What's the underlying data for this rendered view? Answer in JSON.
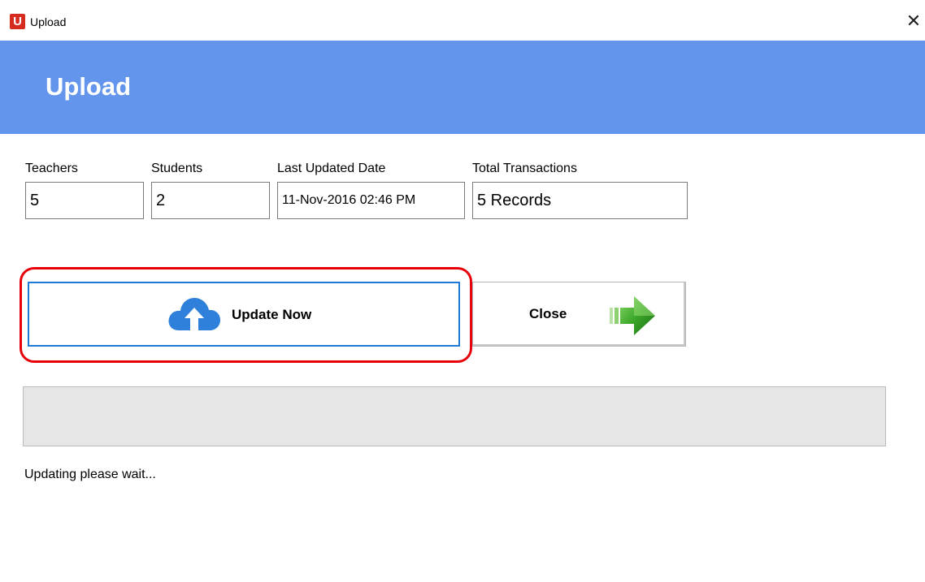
{
  "window": {
    "app_icon_letter": "U",
    "title": "Upload",
    "close_glyph": "✕"
  },
  "header": {
    "title": "Upload",
    "background_color": "#6495ed"
  },
  "fields": {
    "teachers": {
      "label": "Teachers",
      "value": "5"
    },
    "students": {
      "label": "Students",
      "value": "2"
    },
    "last_updated": {
      "label": "Last Updated Date",
      "value": "11-Nov-2016 02:46 PM"
    },
    "total_transactions": {
      "label": "Total Transactions",
      "value": "5 Records"
    }
  },
  "buttons": {
    "update_now": {
      "label": "Update Now",
      "icon": "cloud-upload-icon",
      "focused": true,
      "highlighted": true
    },
    "close": {
      "label": "Close",
      "icon": "arrow-right-icon"
    }
  },
  "progress": {
    "value_percent": 0
  },
  "status": {
    "text": "Updating please wait..."
  },
  "colors": {
    "accent_blue": "#1e78d7",
    "highlight_red": "#e8000b",
    "arrow_green": "#3aa629"
  }
}
